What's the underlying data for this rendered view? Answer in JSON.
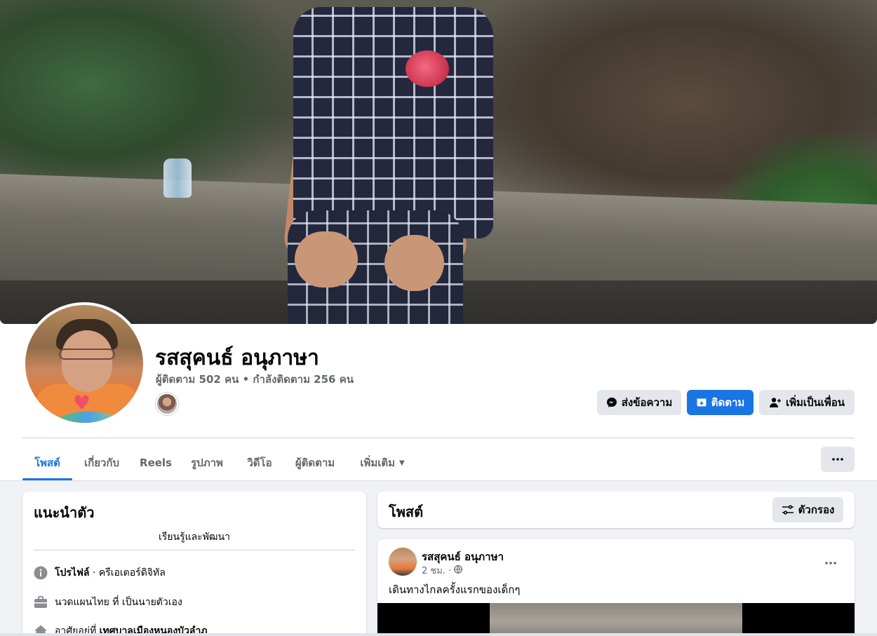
{
  "profile": {
    "name": "รสสุคนธ์ อนุภาษา",
    "stats": "ผู้ติดตาม 502 คน • กำลังติดตาม 256 คน"
  },
  "actions": {
    "message_label": "ส่งข้อความ",
    "follow_label": "ติดตาม",
    "add_friend_label": "เพิ่มเป็นเพื่อน"
  },
  "tabs": [
    {
      "label": "โพสต์",
      "active": true
    },
    {
      "label": "เกี่ยวกับ"
    },
    {
      "label": "Reels"
    },
    {
      "label": "รูปภาพ"
    },
    {
      "label": "วิดีโอ"
    },
    {
      "label": "ผู้ติดตาม"
    },
    {
      "label": "เพิ่มเติม"
    }
  ],
  "intro": {
    "title": "แนะนำตัว",
    "bio": "เรียนรู้และพัฒนา",
    "profile_label": "โปรไฟล์",
    "profile_value": " · ครีเอเตอร์ดิจิทัล",
    "work": "นวดแผนไทย ที่ เป็นนายตัวเอง",
    "lives_prefix": "อาศัยอยู่ที่ ",
    "lives_value": "เทศบาลเมืองหนองบัวลำภู"
  },
  "posts_header": {
    "title": "โพสต์",
    "filter_label": "ตัวกรอง"
  },
  "post": {
    "author": "รสสุคนธ์ อนุภาษา",
    "time": "2 ชม. ·",
    "privacy_icon": "globe-icon",
    "text": "เดินทางไกลครั้งแรกของเด็กๆ"
  },
  "colors": {
    "accent": "#1b74e4",
    "background": "#f0f2f5",
    "secondary_text": "#65676b"
  }
}
